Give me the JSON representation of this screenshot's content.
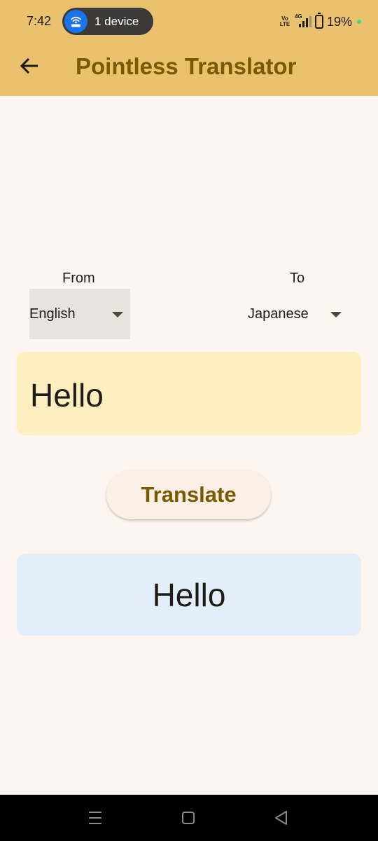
{
  "status_bar": {
    "time": "7:42",
    "hotspot_label": "1 device",
    "network_type": "4G",
    "volte": "Vo LTE",
    "battery": "19%"
  },
  "app_bar": {
    "title": "Pointless Translator",
    "back_icon": "arrow-left-icon"
  },
  "translator": {
    "from_label": "From",
    "to_label": "To",
    "from_value": "English",
    "to_value": "Japanese",
    "input_text": "Hello",
    "translate_label": "Translate",
    "output_text": "Hello"
  },
  "nav_bar": {
    "icons": [
      "menu-icon",
      "home-icon",
      "back-triangle-icon"
    ]
  },
  "colors": {
    "app_bar_bg": "#e9c16f",
    "title_color": "#7a5a00",
    "page_bg": "#fdf6f0",
    "input_bg": "#ffeebf",
    "output_bg": "#e2effb",
    "button_bg": "#fbf0e5",
    "hotspot_accent": "#1a73e8"
  }
}
